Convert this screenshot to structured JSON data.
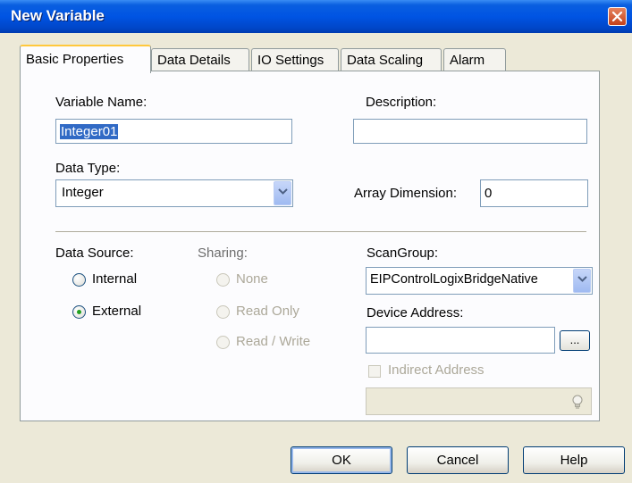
{
  "window": {
    "title": "New Variable"
  },
  "tabs": [
    {
      "label": "Basic Properties",
      "active": true
    },
    {
      "label": "Data Details",
      "active": false
    },
    {
      "label": "IO Settings",
      "active": false
    },
    {
      "label": "Data Scaling",
      "active": false
    },
    {
      "label": "Alarm",
      "active": false
    }
  ],
  "form": {
    "variable_name_label": "Variable Name:",
    "variable_name_value": "Integer01",
    "description_label": "Description:",
    "description_value": "",
    "data_type_label": "Data Type:",
    "data_type_value": "Integer",
    "array_dimension_label": "Array Dimension:",
    "array_dimension_value": "0",
    "data_source_label": "Data Source:",
    "data_source_options": [
      {
        "label": "Internal",
        "selected": false
      },
      {
        "label": "External",
        "selected": true
      }
    ],
    "sharing_label": "Sharing:",
    "sharing_options": [
      {
        "label": "None",
        "selected": false
      },
      {
        "label": "Read Only",
        "selected": false
      },
      {
        "label": "Read / Write",
        "selected": false
      }
    ],
    "scan_group_label": "ScanGroup:",
    "scan_group_value": "EIPControlLogixBridgeNative",
    "device_address_label": "Device Address:",
    "device_address_value": "",
    "browse_button_label": "...",
    "indirect_address_label": "Indirect Address",
    "indirect_address_checked": false
  },
  "buttons": {
    "ok": "OK",
    "cancel": "Cancel",
    "help": "Help"
  },
  "colors": {
    "titlebar": "#0054E3",
    "dialog_bg": "#ECE9D8",
    "tab_accent": "#FFC83C",
    "radio_dot": "#21A121",
    "selection": "#316AC5"
  }
}
